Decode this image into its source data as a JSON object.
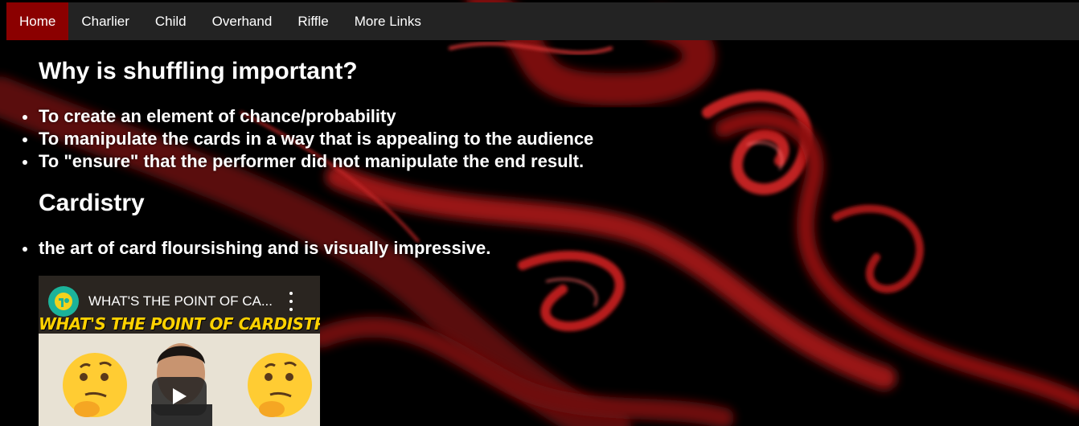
{
  "nav": {
    "items": [
      {
        "label": "Home",
        "active": true
      },
      {
        "label": "Charlier",
        "active": false
      },
      {
        "label": "Child",
        "active": false
      },
      {
        "label": "Overhand",
        "active": false
      },
      {
        "label": "Riffle",
        "active": false
      },
      {
        "label": "More Links",
        "active": false
      }
    ]
  },
  "sections": {
    "why": {
      "heading": "Why is shuffling important?",
      "bullets": [
        "To create an element of chance/probability",
        "To manipulate the cards in a way that is appealing to the audience",
        "To \"ensure\" that the performer did not manipulate the end result."
      ]
    },
    "cardistry": {
      "heading": "Cardistry",
      "bullets": [
        "the art of card floursishing and is visually impressive."
      ]
    }
  },
  "video": {
    "title": "WHAT'S THE POINT OF CA...",
    "thumbnail_text": "WHAT'S THE POINT OF CARDISTRY"
  },
  "colors": {
    "nav_active": "#8b0000",
    "nav_bg": "#232323",
    "smoke": "#b01818",
    "channel_icon": "#1bb39a",
    "thumbnail_text": "#ffd200"
  },
  "icons": {
    "play": "youtube-play-icon",
    "menu": "kebab-menu-icon",
    "channel": "channel-avatar-icon"
  }
}
